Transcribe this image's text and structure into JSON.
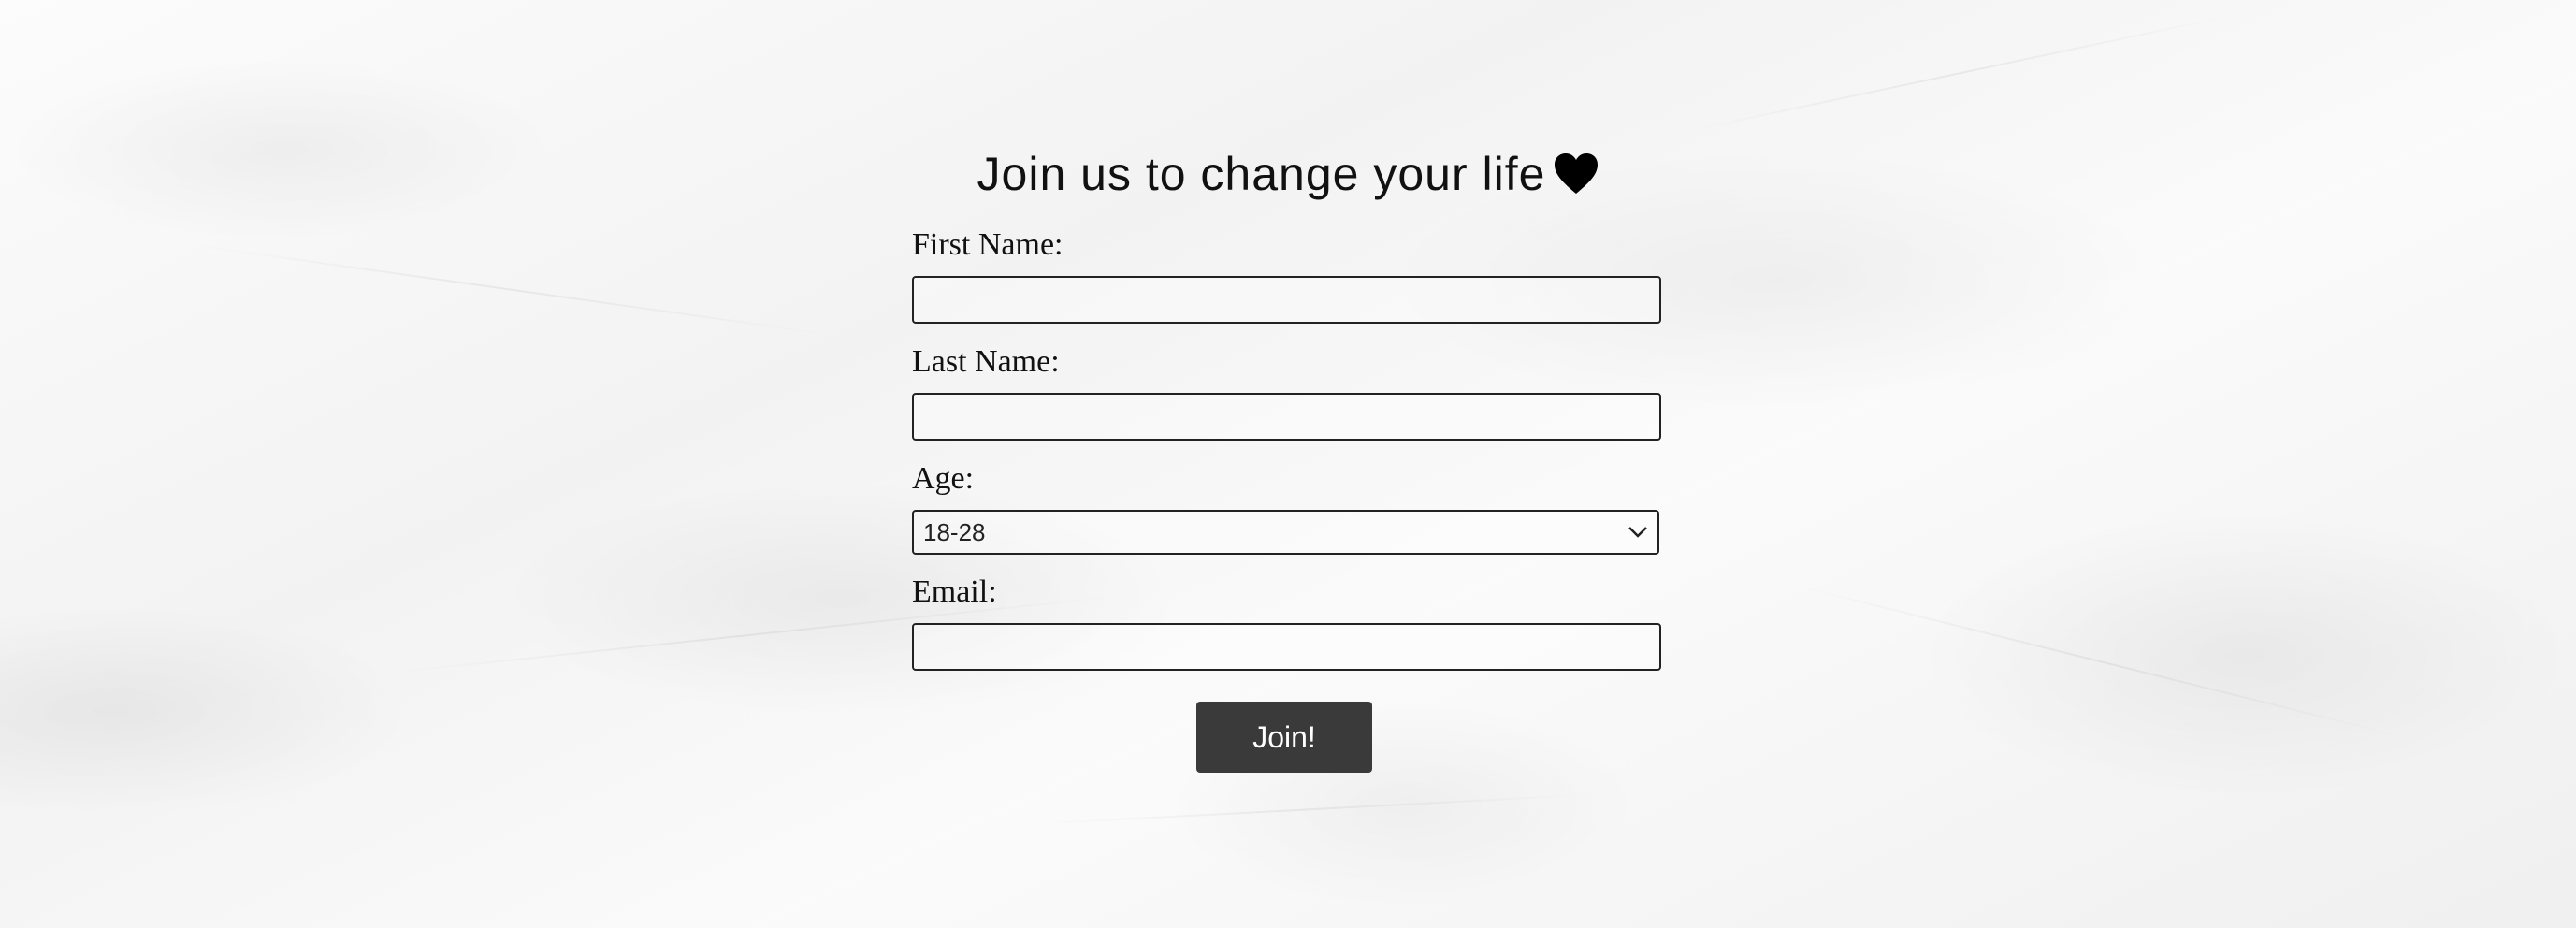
{
  "form": {
    "title": "Join us to change your life",
    "title_icon": "heart-icon",
    "first_name": {
      "label": "First Name:",
      "value": "",
      "placeholder": ""
    },
    "last_name": {
      "label": "Last Name:",
      "value": "",
      "placeholder": ""
    },
    "age": {
      "label": "Age:",
      "selected": "18-28"
    },
    "email": {
      "label": "Email:",
      "value": "",
      "placeholder": ""
    },
    "submit_label": "Join!"
  }
}
